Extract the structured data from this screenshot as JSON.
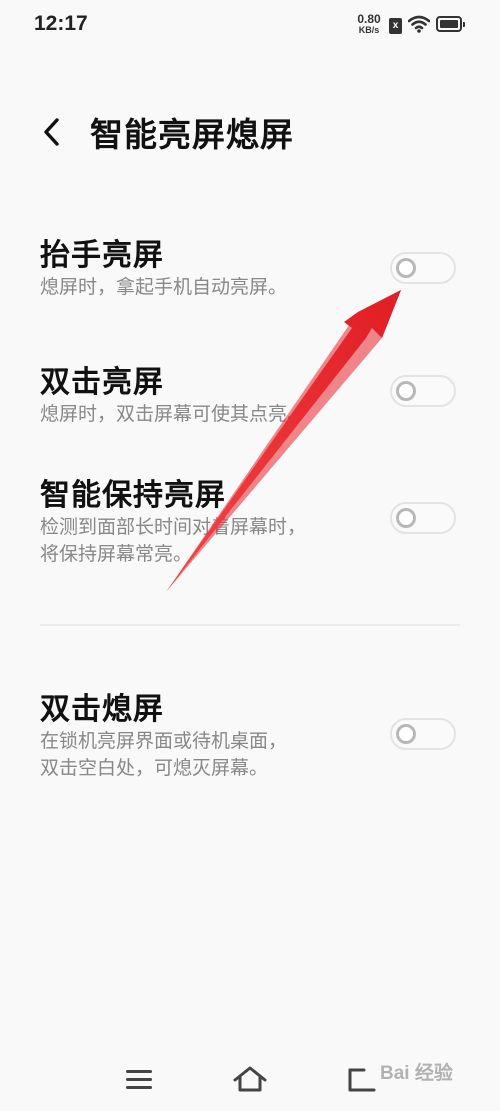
{
  "status_bar": {
    "time": "12:17",
    "net_speed_value": "0.80",
    "net_speed_unit": "KB/s",
    "sim_label": "x"
  },
  "header": {
    "back_icon": "chevron-left-icon",
    "title": "智能亮屏熄屏"
  },
  "settings": [
    {
      "title": "抬手亮屏",
      "description": "熄屏时，拿起手机自动亮屏。",
      "enabled": false
    },
    {
      "title": "双击亮屏",
      "description": "熄屏时，双击屏幕可使其点亮。",
      "enabled": false
    },
    {
      "title": "智能保持亮屏",
      "description": "检测到面部长时间对着屏幕时，\n将保持屏幕常亮。",
      "enabled": false
    },
    {
      "title": "双击熄屏",
      "description": "在锁机亮屏界面或待机桌面，\n双击空白处，可熄灭屏幕。",
      "enabled": false
    }
  ],
  "nav_bar": {
    "menu_icon": "menu-icon",
    "home_icon": "home-icon",
    "back_icon": "back-icon"
  },
  "annotation": {
    "arrow_color": "#e8262b"
  },
  "watermark": "Bai 经验"
}
